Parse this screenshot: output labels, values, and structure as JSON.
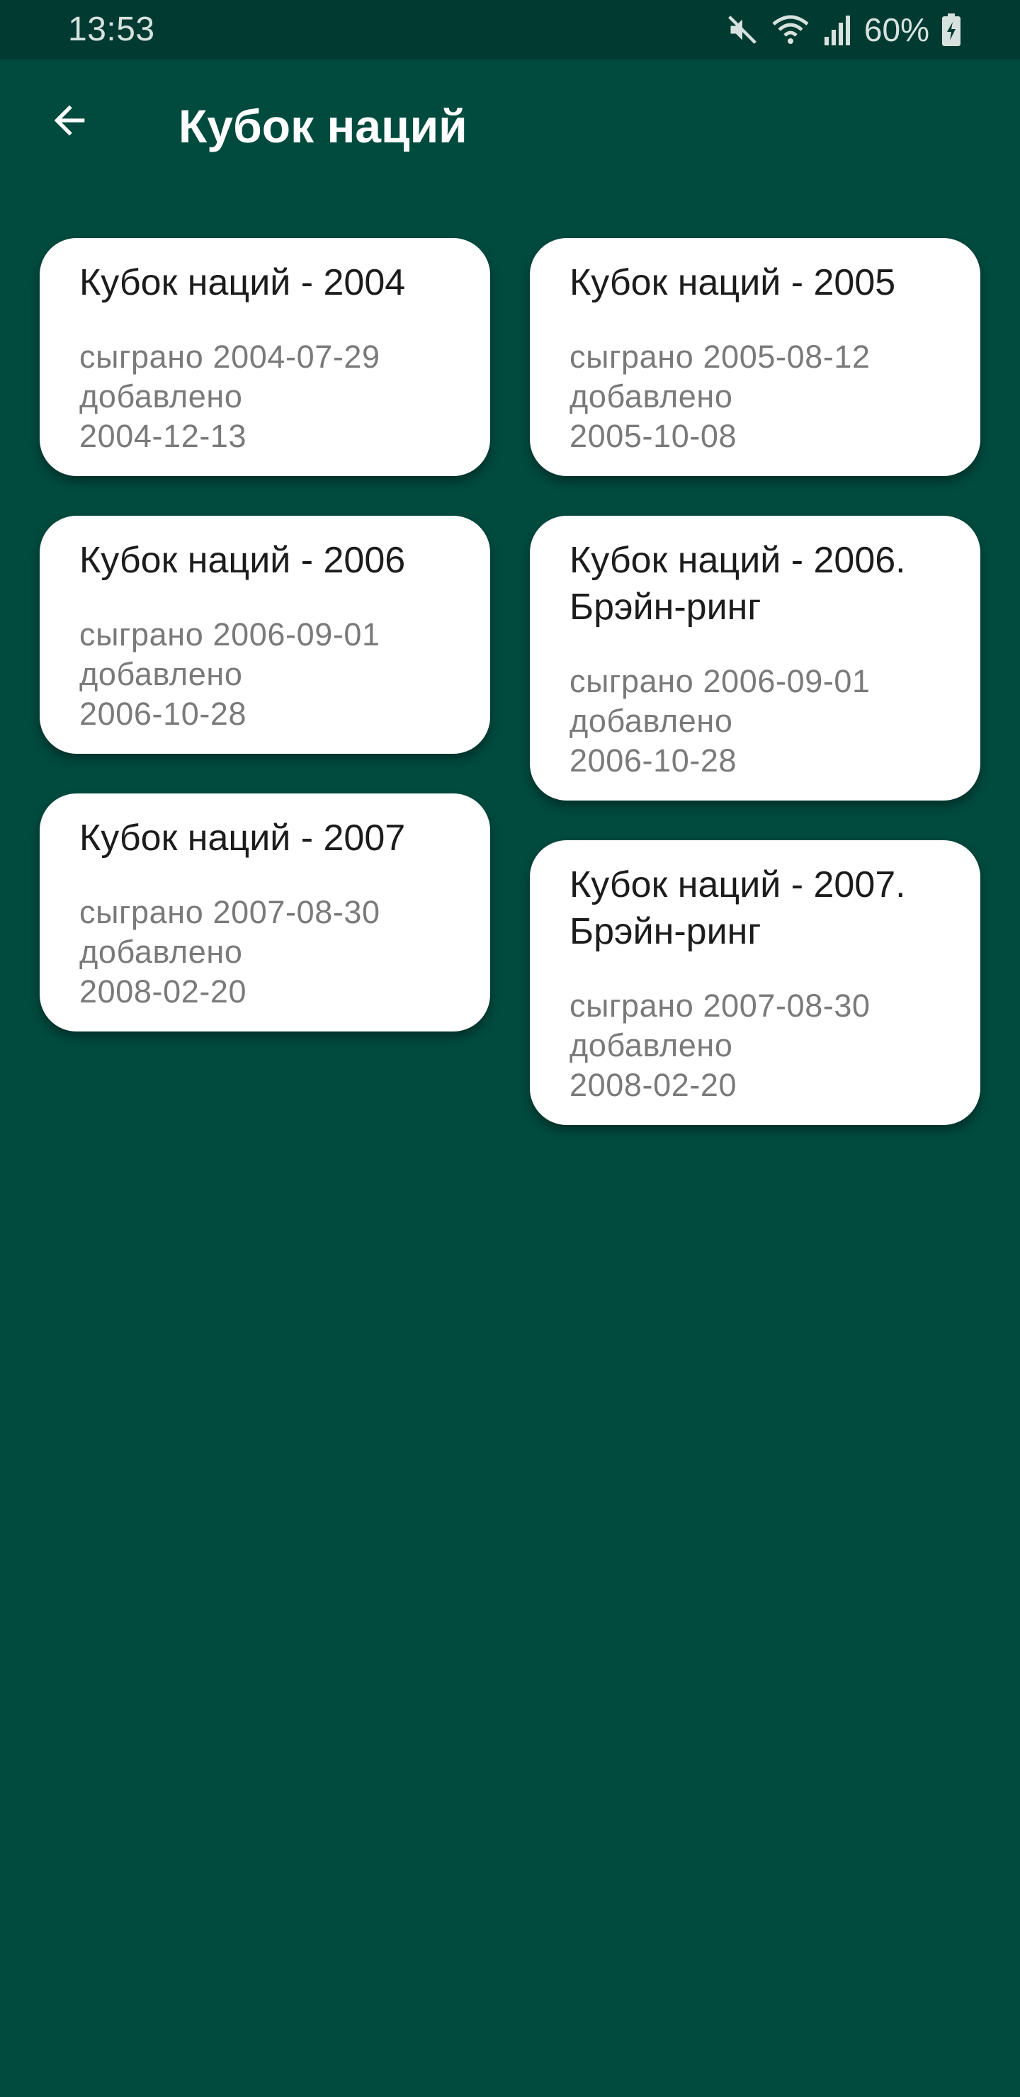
{
  "status_bar": {
    "time": "13:53",
    "battery": "60%",
    "icons": [
      "mute-icon",
      "wifi-icon",
      "signal-icon",
      "battery-icon"
    ]
  },
  "app_bar": {
    "title": "Кубок наций",
    "back_icon": "arrow-back-icon"
  },
  "colors": {
    "background": "#004a3e",
    "status_bar": "#003a31",
    "card": "#ffffff"
  },
  "cards": [
    {
      "title": "Кубок наций - 2004",
      "played": "сыграно 2004-07-29",
      "added_label": "добавлено",
      "added_date": "2004-12-13"
    },
    {
      "title": "Кубок наций - 2005",
      "played": "сыграно 2005-08-12",
      "added_label": "добавлено",
      "added_date": "2005-10-08"
    },
    {
      "title": "Кубок наций - 2006",
      "played": "сыграно 2006-09-01",
      "added_label": "добавлено",
      "added_date": "2006-10-28"
    },
    {
      "title": "Кубок наций - 2006. Брэйн-ринг",
      "played": "сыграно 2006-09-01",
      "added_label": "добавлено",
      "added_date": "2006-10-28"
    },
    {
      "title": "Кубок наций - 2007",
      "played": "сыграно 2007-08-30",
      "added_label": "добавлено",
      "added_date": "2008-02-20"
    },
    {
      "title": "Кубок наций - 2007. Брэйн-ринг",
      "played": "сыграно 2007-08-30",
      "added_label": "добавлено",
      "added_date": "2008-02-20"
    }
  ]
}
